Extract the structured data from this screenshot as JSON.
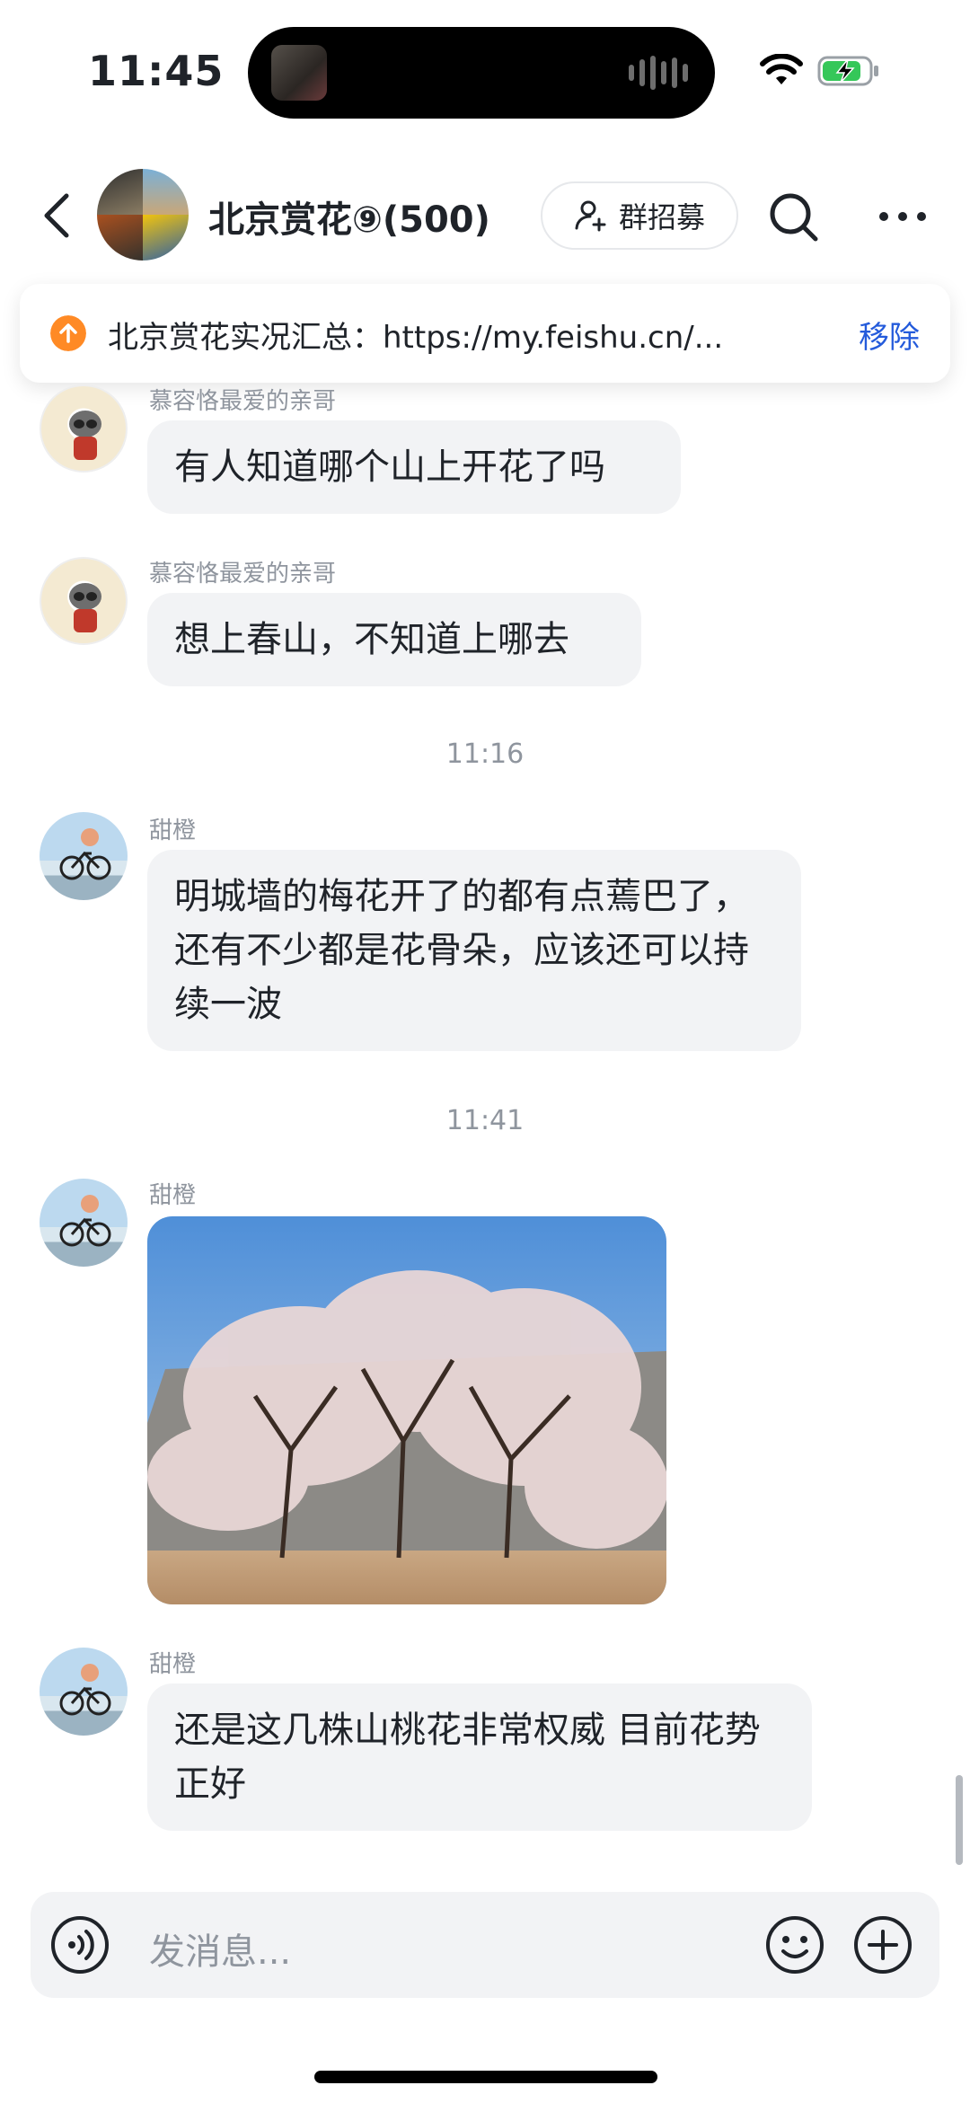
{
  "status_bar": {
    "time": "11:45"
  },
  "header": {
    "title": "北京赏花⑨(500)",
    "recruit_label": "群招募"
  },
  "pinned": {
    "text": "北京赏花实况汇总：https://my.feishu.cn/...",
    "remove_label": "移除"
  },
  "messages": [
    {
      "sender": "慕容恪最爱的亲哥",
      "text": "有人知道哪个山上开花了吗"
    },
    {
      "sender": "慕容恪最爱的亲哥",
      "text": "想上春山，不知道上哪去"
    },
    {
      "timestamp": "11:16"
    },
    {
      "sender": "甜橙",
      "text": "明城墙的梅花开了的都有点蔫巴了，还有不少都是花骨朵，应该还可以持续一波"
    },
    {
      "timestamp": "11:41"
    },
    {
      "sender": "甜橙",
      "type": "image"
    },
    {
      "sender": "甜橙",
      "text": "还是这几株山桃花非常权威 目前花势正好"
    }
  ],
  "input": {
    "placeholder": "发消息..."
  },
  "colors": {
    "accent": "#245bdb",
    "bubble": "#f2f3f5",
    "pin": "#ff8a25"
  }
}
